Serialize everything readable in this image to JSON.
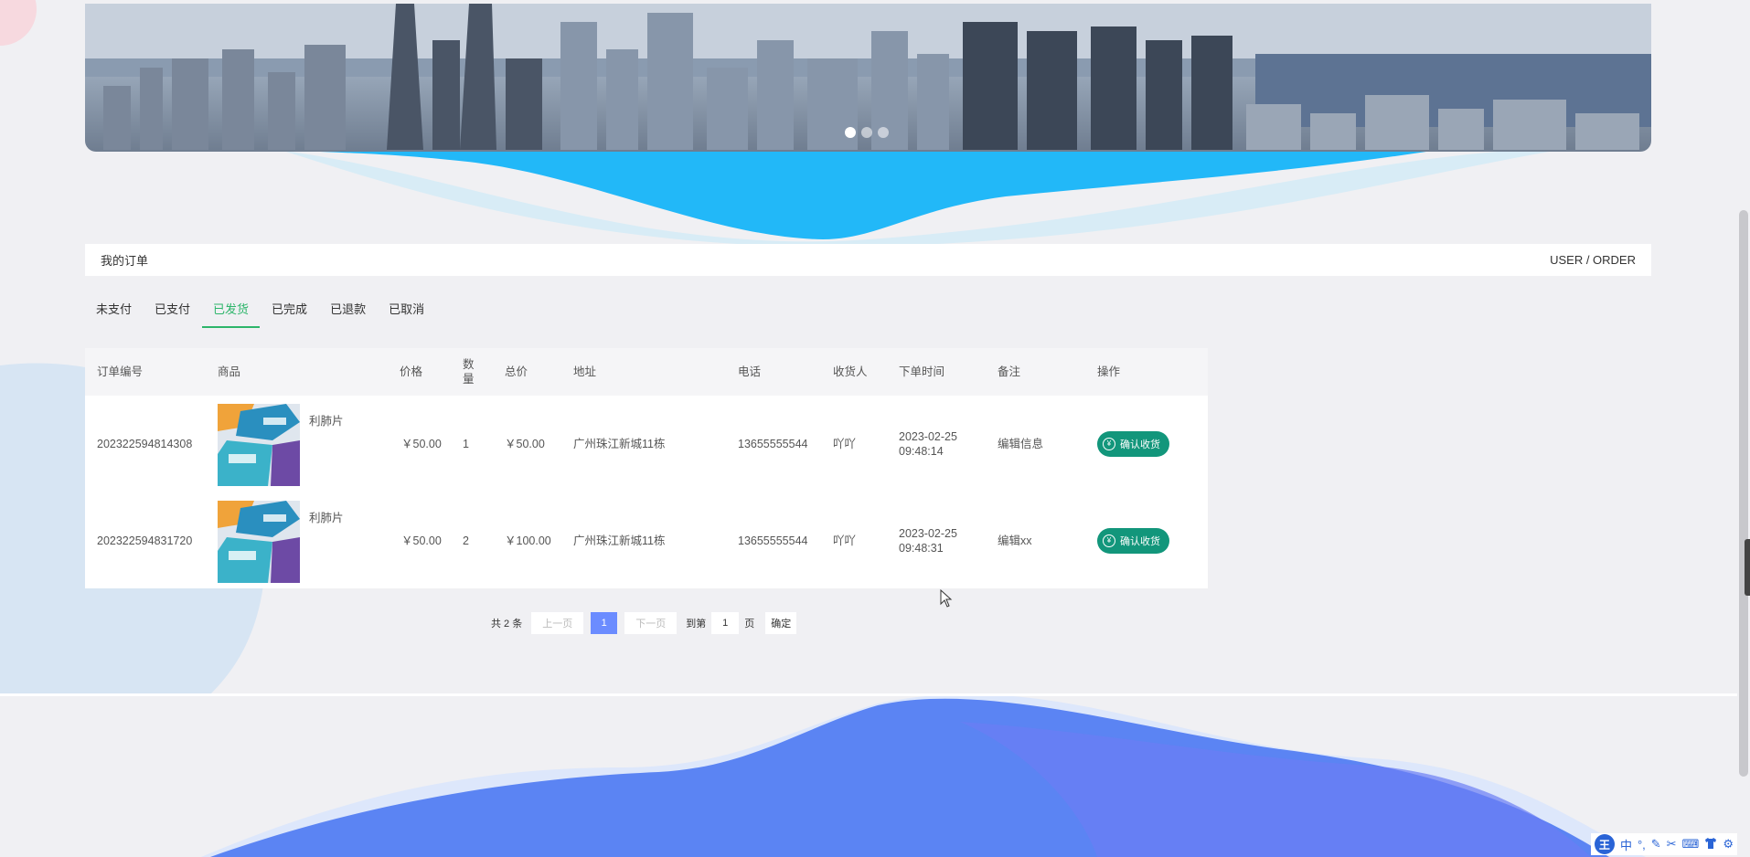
{
  "banner": {
    "dots": [
      "slide-1",
      "slide-2",
      "slide-3"
    ],
    "active_dot": 0
  },
  "header": {
    "title": "我的订单",
    "breadcrumb": "USER / ORDER"
  },
  "tabs": [
    {
      "label": "未支付",
      "active": false
    },
    {
      "label": "已支付",
      "active": false
    },
    {
      "label": "已发货",
      "active": true
    },
    {
      "label": "已完成",
      "active": false
    },
    {
      "label": "已退款",
      "active": false
    },
    {
      "label": "已取消",
      "active": false
    }
  ],
  "table": {
    "columns": {
      "order_no": "订单编号",
      "product": "商品",
      "price": "价格",
      "qty_line1": "数",
      "qty_line2": "量",
      "total": "总价",
      "address": "地址",
      "phone": "电话",
      "receiver": "收货人",
      "time": "下单时间",
      "note": "备注",
      "action": "操作"
    },
    "rows": [
      {
        "order_no": "202322594814308",
        "product": "利肺片",
        "price": "￥50.00",
        "qty": "1",
        "total": "￥50.00",
        "address": "广州珠江新城11栋",
        "phone": "13655555544",
        "receiver": "吖吖",
        "date": "2023-02-25",
        "time": "09:48:14",
        "note": "编辑信息",
        "action": "确认收货"
      },
      {
        "order_no": "202322594831720",
        "product": "利肺片",
        "price": "￥50.00",
        "qty": "2",
        "total": "￥100.00",
        "address": "广州珠江新城11栋",
        "phone": "13655555544",
        "receiver": "吖吖",
        "date": "2023-02-25",
        "time": "09:48:31",
        "note": "编辑xx",
        "action": "确认收货"
      }
    ],
    "action_icon": "yen-circle-icon"
  },
  "pagination": {
    "total": "共 2 条",
    "prev": "上一页",
    "current": "1",
    "next": "下一页",
    "goto_label": "到第",
    "goto_value": "1",
    "page_unit": "页",
    "confirm": "确定"
  },
  "ime": {
    "logo": "王",
    "mode": "中",
    "punct": "°,",
    "icons": [
      "pen-icon",
      "scissors-icon",
      "keyboard-icon",
      "shirt-icon",
      "gear-icon"
    ]
  },
  "colors": {
    "accent_green": "#2db56a",
    "button_teal": "#12967b",
    "pager_blue": "#6b8cff",
    "wave_cyan": "#1fb4f7",
    "wave_blue": "#4f7cf2"
  }
}
